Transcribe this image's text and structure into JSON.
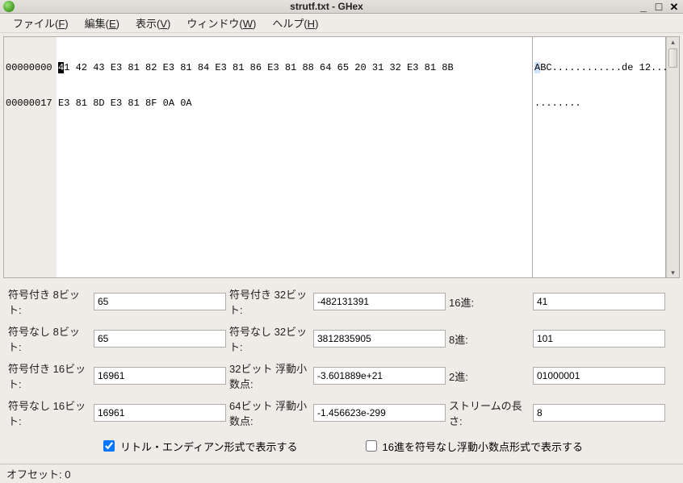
{
  "window": {
    "title": "strutf.txt - GHex"
  },
  "menu": {
    "file": "ファイル(F)",
    "edit": "編集(E)",
    "view": "表示(V)",
    "window": "ウィンドウ(W)",
    "help": "ヘルプ(H)"
  },
  "hex": {
    "offsets": [
      "00000000",
      "00000017"
    ],
    "rows": [
      {
        "cursor_nibble": "4",
        "rest": "1 42 43 E3 81 82 E3 81 84 E3 81 86 E3 81 88 64 65 20 31 32 E3 81 8B"
      },
      {
        "cursor_nibble": "",
        "rest": "E3 81 8D E3 81 8F 0A 0A"
      }
    ],
    "ascii_rows": [
      {
        "sel": "A",
        "rest": "BC............de 12..."
      },
      {
        "sel": "",
        "rest": "........"
      }
    ]
  },
  "conv": {
    "s8_label": "符号付き 8ビット:",
    "s8": "65",
    "u8_label": "符号なし 8ビット:",
    "u8": "65",
    "s16_label": "符号付き 16ビット:",
    "s16": "16961",
    "u16_label": "符号なし 16ビット:",
    "u16": "16961",
    "s32_label": "符号付き 32ビット:",
    "s32": "-482131391",
    "u32_label": "符号なし 32ビット:",
    "u32": "3812835905",
    "f32_label": "32ビット 浮動小数点:",
    "f32": "-3.601889e+21",
    "f64_label": "64ビット 浮動小数点:",
    "f64": "-1.456623e-299",
    "hex_label": "16進:",
    "hex": "41",
    "oct_label": "8進:",
    "oct": "101",
    "bin_label": "2進:",
    "bin": "01000001",
    "stream_label": "ストリームの長さ:",
    "stream": "8"
  },
  "options": {
    "little_endian": "リトル・エンディアン形式で表示する",
    "little_endian_checked": true,
    "hex_unsigned_float": "16進を符号なし浮動小数点形式で表示する",
    "hex_unsigned_float_checked": false
  },
  "status": {
    "offset": "オフセット: 0"
  }
}
